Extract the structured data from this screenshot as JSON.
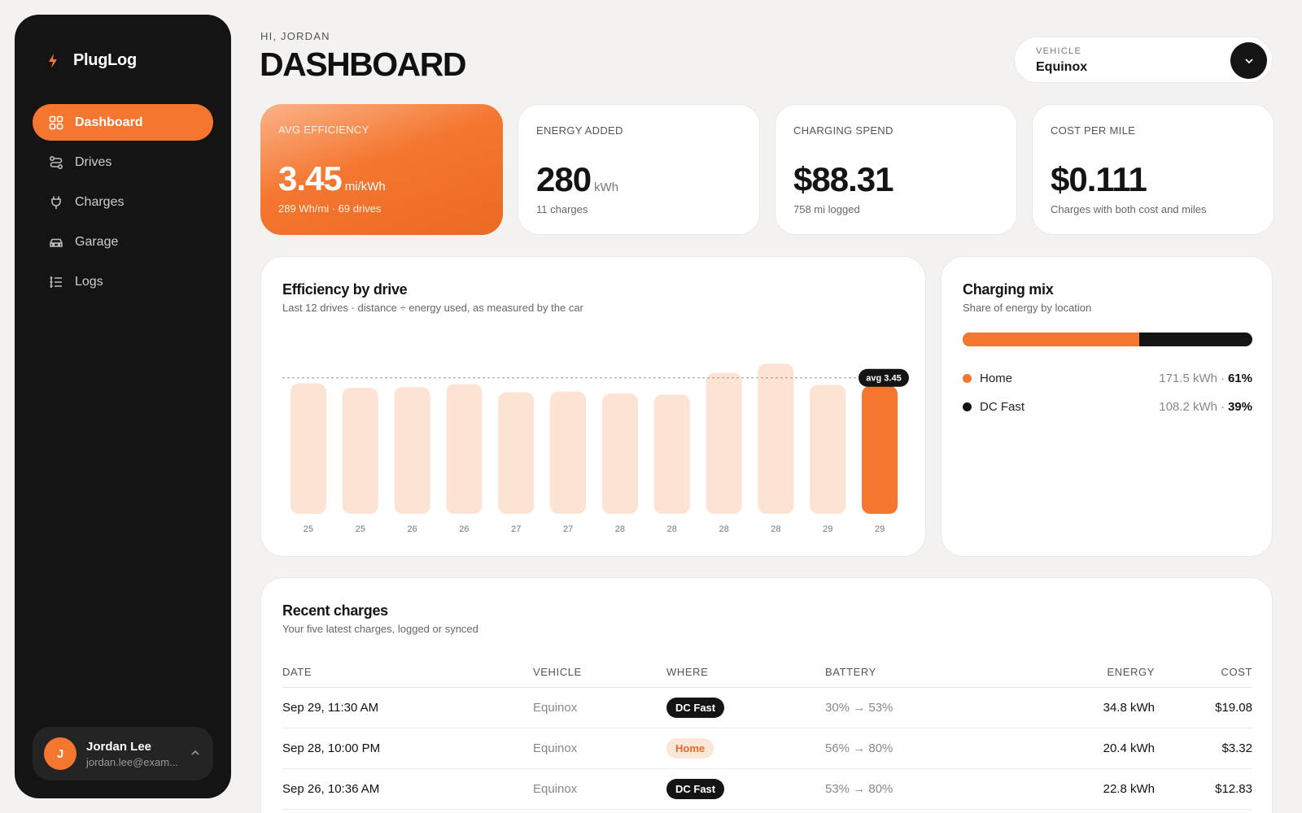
{
  "app": {
    "brand": "PlugLog",
    "nav": [
      {
        "label": "Dashboard",
        "icon": "grid-icon",
        "active": true
      },
      {
        "label": "Drives",
        "icon": "route-icon",
        "active": false
      },
      {
        "label": "Charges",
        "icon": "plug-icon",
        "active": false
      },
      {
        "label": "Garage",
        "icon": "car-icon",
        "active": false
      },
      {
        "label": "Logs",
        "icon": "list-icon",
        "active": false
      }
    ],
    "user": {
      "initial": "J",
      "name": "Jordan Lee",
      "email": "jordan.lee@exam..."
    }
  },
  "header": {
    "greeting": "HI, JORDAN",
    "title": "DASHBOARD",
    "vehicle_label": "VEHICLE",
    "vehicle_value": "Equinox"
  },
  "stats": [
    {
      "label": "AVG EFFICIENCY",
      "value": "3.45",
      "unit": "mi/kWh",
      "sub": "289 Wh/mi · 69 drives"
    },
    {
      "label": "ENERGY ADDED",
      "value": "280",
      "unit": "kWh",
      "sub": "11 charges"
    },
    {
      "label": "CHARGING SPEND",
      "value": "$88.31",
      "unit": "",
      "sub": "758 mi logged"
    },
    {
      "label": "COST PER MILE",
      "value": "$0.111",
      "unit": "",
      "sub": "Charges with both cost and miles"
    }
  ],
  "efficiency_panel": {
    "title": "Efficiency by drive",
    "subtitle": "Last 12 drives · distance ÷ energy used, as measured by the car"
  },
  "chart_data": {
    "type": "bar",
    "categories": [
      "25",
      "25",
      "26",
      "26",
      "27",
      "27",
      "28",
      "28",
      "28",
      "28",
      "29",
      "29"
    ],
    "values": [
      3.52,
      3.4,
      3.42,
      3.5,
      3.28,
      3.3,
      3.25,
      3.22,
      3.8,
      4.05,
      3.48,
      3.45
    ],
    "highlight_index": 11,
    "average": 3.45,
    "average_label": "avg 3.45",
    "ylim": [
      0,
      4.3
    ],
    "colors": {
      "bar": "#fde3d3",
      "highlight": "#f4762f",
      "avg_line": "#9a9a9a"
    }
  },
  "mix_panel": {
    "title": "Charging mix",
    "subtitle": "Share of energy by location",
    "home_share": 0.61,
    "rows": [
      {
        "name": "Home",
        "kwh": "171.5 kWh",
        "pct": "61%",
        "color": "#f4762f"
      },
      {
        "name": "DC Fast",
        "kwh": "108.2 kWh",
        "pct": "39%",
        "color": "#141414"
      }
    ]
  },
  "recent_charges": {
    "title": "Recent charges",
    "subtitle": "Your five latest charges, logged or synced",
    "columns": [
      "DATE",
      "VEHICLE",
      "WHERE",
      "BATTERY",
      "ENERGY",
      "COST"
    ],
    "rows": [
      {
        "date": "Sep 29, 11:30 AM",
        "vehicle": "Equinox",
        "where": "DC Fast",
        "battery": "30% → 53%",
        "energy": "34.8 kWh",
        "cost": "$19.08"
      },
      {
        "date": "Sep 28, 10:00 PM",
        "vehicle": "Equinox",
        "where": "Home",
        "battery": "56% → 80%",
        "energy": "20.4 kWh",
        "cost": "$3.32"
      },
      {
        "date": "Sep 26, 10:36 AM",
        "vehicle": "Equinox",
        "where": "DC Fast",
        "battery": "53% → 80%",
        "energy": "22.8 kWh",
        "cost": "$12.83"
      }
    ]
  }
}
